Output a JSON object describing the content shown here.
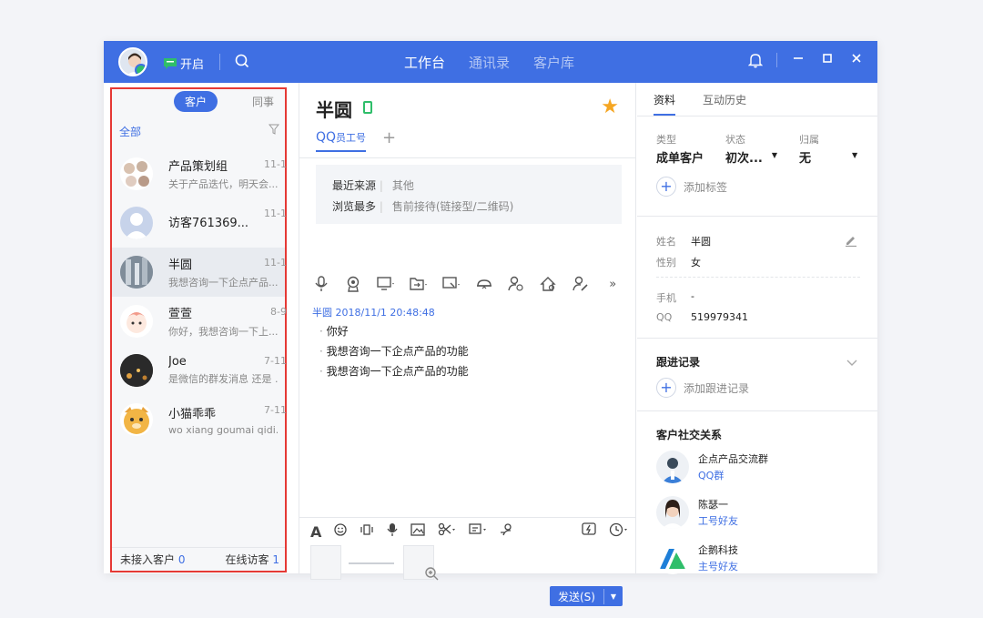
{
  "topbar": {
    "status_label": "开启",
    "tabs": [
      {
        "label": "工作台",
        "active": true
      },
      {
        "label": "通讯录",
        "active": false
      },
      {
        "label": "客户库",
        "active": false
      }
    ],
    "accent": "#3f6fe3"
  },
  "left": {
    "seg_customer": "客户",
    "seg_colleague": "同事",
    "filter_all": "全部",
    "contacts": [
      {
        "name": "产品策划组",
        "msg": "关于产品迭代，明天会...",
        "time": "11-1"
      },
      {
        "name": "访客761369...",
        "msg": "",
        "time": "11-1"
      },
      {
        "name": "半圆",
        "msg": "我想咨询一下企点产品...",
        "time": "11-1"
      },
      {
        "name": "萱萱",
        "msg": "你好，我想咨询一下上...",
        "time": "8-9"
      },
      {
        "name": "Joe",
        "msg": "是微信的群发消息 还是 ...",
        "time": "7-11"
      },
      {
        "name": "小猫乖乖",
        "msg": "wo xiang goumai qidi...",
        "time": "7-11"
      }
    ],
    "footer_unassigned_label": "未接入客户",
    "footer_unassigned_count": "0",
    "footer_online_label": "在线访客",
    "footer_online_count": "1"
  },
  "chat": {
    "name": "半圆",
    "tab_main": "QQ",
    "tab_sub": "员工号",
    "source_label": "最近来源",
    "source_value": "其他",
    "browse_label": "浏览最多",
    "browse_value": "售前接待(链接型/二维码)",
    "msg_header": "半圆 2018/11/1 20:48:48",
    "messages": [
      "你好",
      "我想咨询一下企点产品的功能",
      "我想咨询一下企点产品的功能"
    ],
    "send_label": "发送(S)"
  },
  "profile": {
    "tab_info": "资料",
    "tab_history": "互动历史",
    "type_label": "类型",
    "type_value": "成单客户",
    "state_label": "状态",
    "state_value": "初次...",
    "owner_label": "归属",
    "owner_value": "无",
    "add_tag": "添加标签",
    "name_label": "姓名",
    "name_value": "半圆",
    "gender_label": "性别",
    "gender_value": "女",
    "mobile_label": "手机",
    "mobile_value": "-",
    "qq_label": "QQ",
    "qq_value": "519979341",
    "follow_title": "跟进记录",
    "add_follow": "添加跟进记录",
    "social_title": "客户社交关系",
    "social": [
      {
        "name": "企点产品交流群",
        "type": "QQ群"
      },
      {
        "name": "陈瑟一",
        "type": "工号好友"
      },
      {
        "name": "企鹅科技",
        "type": "主号好友"
      }
    ]
  }
}
